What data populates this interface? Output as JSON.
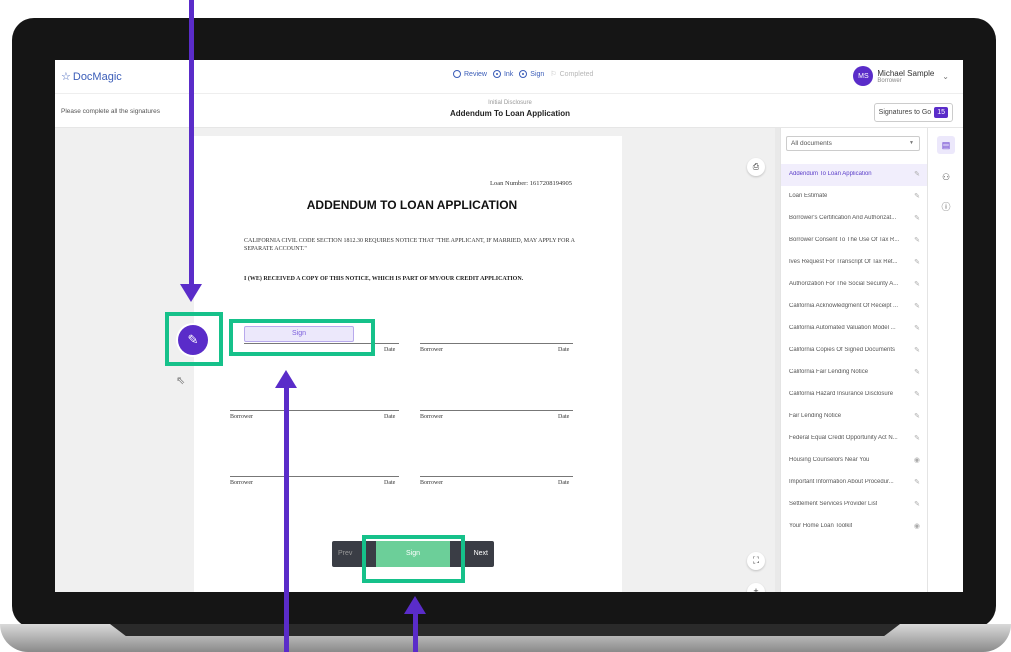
{
  "app": {
    "logo": "DocMagic",
    "steps": [
      {
        "label": "Review",
        "state": "done"
      },
      {
        "label": "Ink",
        "state": "active"
      },
      {
        "label": "Sign",
        "state": "active"
      },
      {
        "label": "Completed",
        "state": "pending"
      }
    ],
    "user": {
      "initials": "MS",
      "name": "Michael Sample",
      "role": "Borrower"
    }
  },
  "subheader": {
    "note": "Please complete all the signatures",
    "kicker": "Initial Disclosure",
    "title": "Addendum To Loan Application",
    "signatures_label": "Signatures to Go",
    "signatures_count": "15"
  },
  "document": {
    "loan_number": "Loan Number: 1617208194905",
    "title": "ADDENDUM TO LOAN APPLICATION",
    "paragraph": "CALIFORNIA CIVIL CODE SECTION 1812.30 REQUIRES NOTICE THAT \"THE APPLICANT, IF MARRIED, MAY APPLY FOR A SEPARATE ACCOUNT.\"",
    "acknowledgement": "I (WE) RECEIVED A COPY OF THIS NOTICE, WHICH IS PART OF MY/OUR CREDIT APPLICATION.",
    "sign_field_label": "Sign",
    "borrower_label": "Borrower",
    "date_label": "Date"
  },
  "doc_nav": {
    "prev": "Prev",
    "sign": "Sign",
    "next": "Next"
  },
  "doc_select": {
    "value": "All documents"
  },
  "documents": [
    {
      "label": "Addendum To Loan Application",
      "action": "pencil",
      "active": true
    },
    {
      "label": "Loan Estimate",
      "action": "pencil"
    },
    {
      "label": "Borrower's Certification And Authorizat...",
      "action": "pencil"
    },
    {
      "label": "Borrower Consent To The Use Of Tax R...",
      "action": "pencil"
    },
    {
      "label": "Ives Request For Transcript Of Tax Ret...",
      "action": "pencil"
    },
    {
      "label": "Authorization For The Social Security A...",
      "action": "pencil"
    },
    {
      "label": "California Acknowledgment Of Receipt ...",
      "action": "pencil"
    },
    {
      "label": "California Automated Valuation Model ...",
      "action": "pencil"
    },
    {
      "label": "California Copies Of Signed Documents",
      "action": "pencil"
    },
    {
      "label": "California Fair Lending Notice",
      "action": "pencil"
    },
    {
      "label": "California Hazard Insurance Disclosure",
      "action": "pencil"
    },
    {
      "label": "Fair Lending Notice",
      "action": "pencil"
    },
    {
      "label": "Federal Equal Credit Opportunity Act N...",
      "action": "pencil"
    },
    {
      "label": "Housing Counselors Near You",
      "action": "eye"
    },
    {
      "label": "Important Information About Procedur...",
      "action": "pencil"
    },
    {
      "label": "Settlement Services Provider List",
      "action": "pencil"
    },
    {
      "label": "Your Home Loan Toolkit",
      "action": "eye"
    }
  ],
  "colors": {
    "brand": "#5a2cc9",
    "highlight": "#16c18a",
    "sign_button": "#6ccf99"
  }
}
